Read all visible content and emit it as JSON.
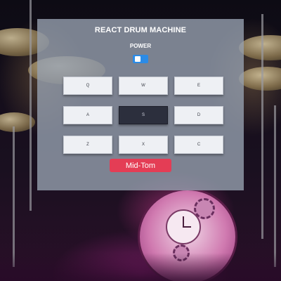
{
  "app": {
    "title": "REACT DRUM MACHINE",
    "power_label": "POWER",
    "power_on": true
  },
  "pads": [
    {
      "key": "Q",
      "active": false
    },
    {
      "key": "W",
      "active": false
    },
    {
      "key": "E",
      "active": false
    },
    {
      "key": "A",
      "active": false
    },
    {
      "key": "S",
      "active": true
    },
    {
      "key": "D",
      "active": false
    },
    {
      "key": "Z",
      "active": false
    },
    {
      "key": "X",
      "active": false
    },
    {
      "key": "C",
      "active": false
    }
  ],
  "display": {
    "text": "Mid-Tom"
  },
  "colors": {
    "accent": "#2b8be6",
    "display_bg": "#e43d55",
    "pad_bg": "#eef0f4",
    "pad_active_bg": "#2c2f3d"
  }
}
